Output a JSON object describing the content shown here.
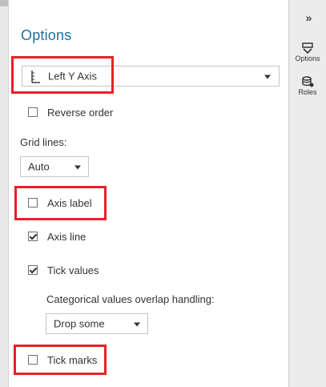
{
  "panel": {
    "title": "Options",
    "axis_select": {
      "value": "Left Y Axis"
    },
    "reverse_order": {
      "label": "Reverse order",
      "checked": false
    },
    "grid_lines": {
      "label": "Grid lines:",
      "value": "Auto"
    },
    "axis_label": {
      "label": "Axis label",
      "checked": false
    },
    "axis_line": {
      "label": "Axis line",
      "checked": true
    },
    "tick_values": {
      "label": "Tick values",
      "checked": true
    },
    "overlap": {
      "label": "Categorical values overlap handling:",
      "value": "Drop some"
    },
    "tick_marks": {
      "label": "Tick marks",
      "checked": false
    }
  },
  "rail": {
    "collapse": "»",
    "options_label": "Options",
    "roles_label": "Roles"
  },
  "highlight_color": "#e8202a",
  "accent_color": "#1e6fa0"
}
